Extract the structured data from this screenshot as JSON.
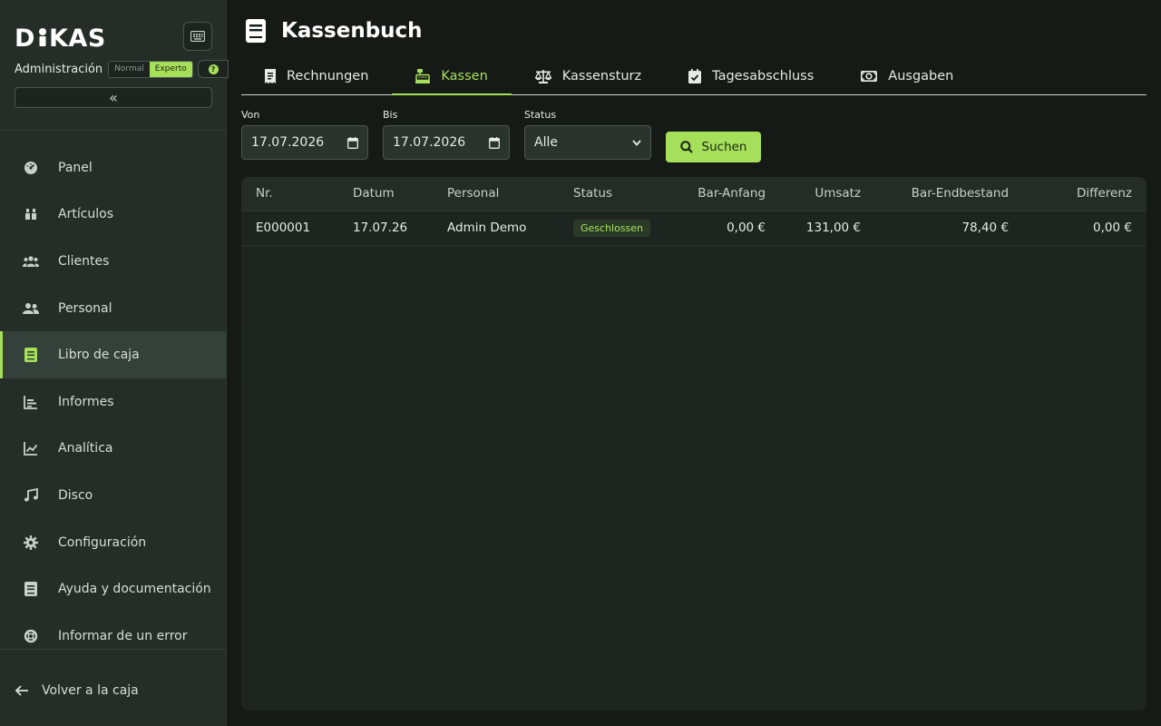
{
  "sidebar": {
    "logo": "DiKAS",
    "admin_label": "Administración",
    "mode_normal": "Normal",
    "mode_experto": "Experto",
    "collapse_glyph": "«",
    "nav": [
      {
        "label": "Panel",
        "icon": "dashboard-icon"
      },
      {
        "label": "Artículos",
        "icon": "articles-icon"
      },
      {
        "label": "Clientes",
        "icon": "clients-icon"
      },
      {
        "label": "Personal",
        "icon": "staff-icon"
      },
      {
        "label": "Libro de caja",
        "icon": "cashbook-icon",
        "active": true
      },
      {
        "label": "Informes",
        "icon": "reports-icon"
      },
      {
        "label": "Analítica",
        "icon": "analytics-icon"
      },
      {
        "label": "Disco",
        "icon": "music-icon"
      },
      {
        "label": "Configuración",
        "icon": "gear-icon"
      },
      {
        "label": "Ayuda y documentación",
        "icon": "help-book-icon"
      },
      {
        "label": "Informar de un error",
        "icon": "lifebuoy-icon"
      }
    ],
    "back_label": "Volver a la caja"
  },
  "main": {
    "title": "Kassenbuch",
    "tabs": [
      {
        "label": "Rechnungen",
        "icon": "receipt-icon"
      },
      {
        "label": "Kassen",
        "icon": "cash-register-icon",
        "active": true
      },
      {
        "label": "Kassensturz",
        "icon": "scale-icon"
      },
      {
        "label": "Tagesabschluss",
        "icon": "calendar-check-icon"
      },
      {
        "label": "Ausgaben",
        "icon": "money-icon"
      }
    ],
    "filters": {
      "von_label": "Von",
      "von_value": "17.07.2026",
      "bis_label": "Bis",
      "bis_value": "17.07.2026",
      "status_label": "Status",
      "status_value": "Alle",
      "search_label": "Suchen"
    },
    "table": {
      "headers": [
        "Nr.",
        "Datum",
        "Personal",
        "Status",
        "Bar-Anfang",
        "Umsatz",
        "Bar-Endbestand",
        "Differenz"
      ],
      "rows": [
        [
          "E000001",
          "17.07.26",
          "Admin Demo",
          "Geschlossen",
          "0,00 €",
          "131,00 €",
          "78,40 €",
          "0,00 €"
        ]
      ]
    }
  },
  "colors": {
    "accent": "#a6e05a",
    "sidebar_bg": "#252d28",
    "page_bg": "#161a17"
  }
}
